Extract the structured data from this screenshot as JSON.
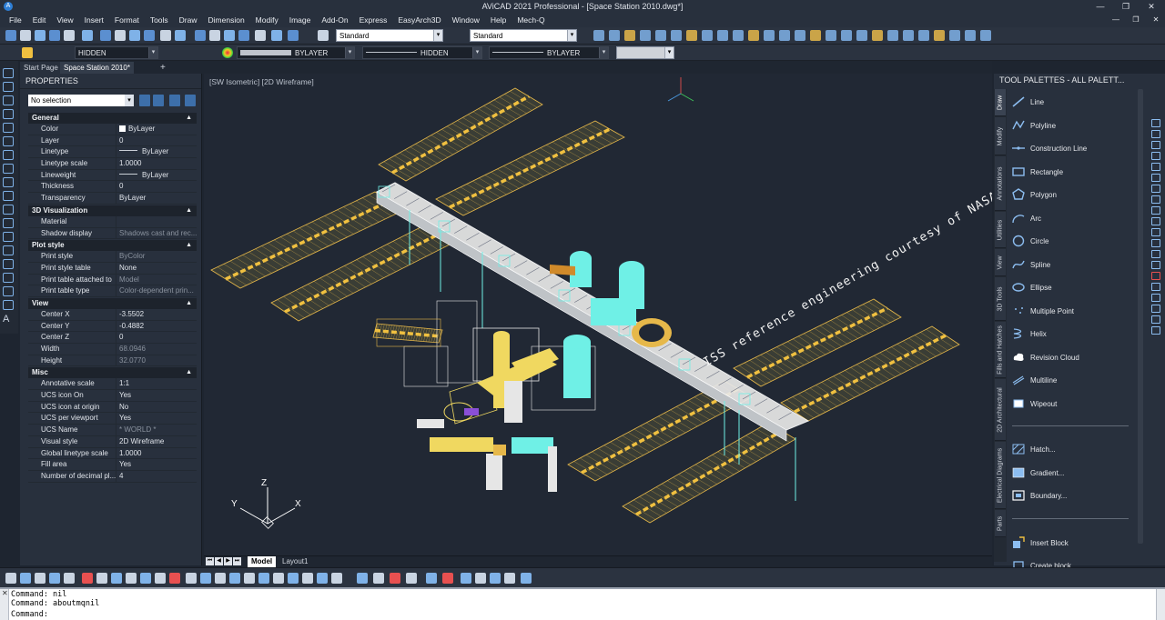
{
  "window": {
    "title": "AViCAD 2021 Professional - [Space Station 2010.dwg*]",
    "minimize": "—",
    "maximize": "❐",
    "close": "✕"
  },
  "menu": [
    "File",
    "Edit",
    "View",
    "Insert",
    "Format",
    "Tools",
    "Draw",
    "Dimension",
    "Modify",
    "Image",
    "Add-On",
    "Express",
    "EasyArch3D",
    "Window",
    "Help",
    "Mech-Q"
  ],
  "toolbar": {
    "text_style": "Standard",
    "dim_style": "Standard",
    "layer": "HIDDEN",
    "color": "BYLAYER",
    "linetype": "HIDDEN",
    "lineweight": "BYLAYER"
  },
  "doc_tabs": {
    "start": "Start Page",
    "active": "Space Station 2010*",
    "add": "+"
  },
  "properties": {
    "title": "PROPERTIES",
    "selection": "No selection",
    "sections": [
      {
        "name": "General",
        "rows": [
          {
            "key": "Color",
            "value": "ByLayer",
            "kind": "swatch"
          },
          {
            "key": "Layer",
            "value": "0"
          },
          {
            "key": "Linetype",
            "value": "ByLayer",
            "kind": "line"
          },
          {
            "key": "Linetype scale",
            "value": "1.0000"
          },
          {
            "key": "Lineweight",
            "value": "ByLayer",
            "kind": "line"
          },
          {
            "key": "Thickness",
            "value": "0"
          },
          {
            "key": "Transparency",
            "value": "ByLayer"
          }
        ]
      },
      {
        "name": "3D Visualization",
        "rows": [
          {
            "key": "Material",
            "value": ""
          },
          {
            "key": "Shadow display",
            "value": "Shadows cast and rec...",
            "dim": true
          }
        ]
      },
      {
        "name": "Plot style",
        "rows": [
          {
            "key": "Print style",
            "value": "ByColor",
            "dim": true
          },
          {
            "key": "Print style table",
            "value": "None"
          },
          {
            "key": "Print table attached to",
            "value": "Model",
            "dim": true
          },
          {
            "key": "Print table type",
            "value": "Color-dependent prin...",
            "dim": true
          }
        ]
      },
      {
        "name": "View",
        "rows": [
          {
            "key": "Center X",
            "value": "-3.5502"
          },
          {
            "key": "Center Y",
            "value": "-0.4882"
          },
          {
            "key": "Center Z",
            "value": "0"
          },
          {
            "key": "Width",
            "value": "68.0946",
            "dim": true
          },
          {
            "key": "Height",
            "value": "32.0770",
            "dim": true
          }
        ]
      },
      {
        "name": "Misc",
        "rows": [
          {
            "key": "Annotative scale",
            "value": "1:1"
          },
          {
            "key": "UCS icon On",
            "value": "Yes"
          },
          {
            "key": "UCS icon at origin",
            "value": "No"
          },
          {
            "key": "UCS per viewport",
            "value": "Yes"
          },
          {
            "key": "UCS Name",
            "value": "* WORLD *",
            "dim": true
          },
          {
            "key": "Visual style",
            "value": "2D Wireframe"
          },
          {
            "key": "Global linetype scale",
            "value": "1.0000"
          },
          {
            "key": "Fill area",
            "value": "Yes"
          },
          {
            "key": "Number of decimal pl...",
            "value": "4"
          }
        ]
      }
    ]
  },
  "viewport": {
    "label": "[SW Isometric] [2D Wireframe]",
    "annotation": "ISS reference engineering courtesy of NASA JSC",
    "ucs": {
      "x": "X",
      "y": "Y",
      "z": "Z"
    }
  },
  "layout_tabs": [
    "Model",
    "Layout1"
  ],
  "tool_palettes": {
    "title": "TOOL PALETTES - ALL PALETT...",
    "tabs": [
      "Draw",
      "Modify",
      "Annotations",
      "Utilities",
      "View",
      "3D Tools",
      "Fills and Hatches",
      "2D Architectural",
      "Electrical Diagrams",
      "Parts"
    ],
    "items": [
      {
        "label": "Line",
        "icon": "line-icon"
      },
      {
        "label": "Polyline",
        "icon": "polyline-icon"
      },
      {
        "label": "Construction Line",
        "icon": "construction-line-icon"
      },
      {
        "label": "Rectangle",
        "icon": "rectangle-icon"
      },
      {
        "label": "Polygon",
        "icon": "polygon-icon"
      },
      {
        "label": "Arc",
        "icon": "arc-icon"
      },
      {
        "label": "Circle",
        "icon": "circle-icon"
      },
      {
        "label": "Spline",
        "icon": "spline-icon"
      },
      {
        "label": "Ellipse",
        "icon": "ellipse-icon"
      },
      {
        "label": "Multiple Point",
        "icon": "point-icon"
      },
      {
        "label": "Helix",
        "icon": "helix-icon"
      },
      {
        "label": "Revision Cloud",
        "icon": "cloud-icon"
      },
      {
        "label": "Multiline",
        "icon": "multiline-icon"
      },
      {
        "label": "Wipeout",
        "icon": "wipeout-icon"
      },
      {
        "label": "Hatch...",
        "icon": "hatch-icon"
      },
      {
        "label": "Gradient...",
        "icon": "gradient-icon"
      },
      {
        "label": "Boundary...",
        "icon": "boundary-icon"
      },
      {
        "label": "Insert Block",
        "icon": "insert-block-icon"
      },
      {
        "label": "Create block",
        "icon": "create-block-icon"
      }
    ]
  },
  "command": {
    "history": [
      "Command: nil",
      "Command: aboutmqnil"
    ],
    "prompt": "Command:"
  },
  "colors": {
    "accent": "#2e7fd6",
    "panel": "#28303d",
    "viewport": "#212834",
    "solar": "#e6b84a",
    "cyan": "#6ff0e6",
    "white": "#f2f2f2"
  }
}
